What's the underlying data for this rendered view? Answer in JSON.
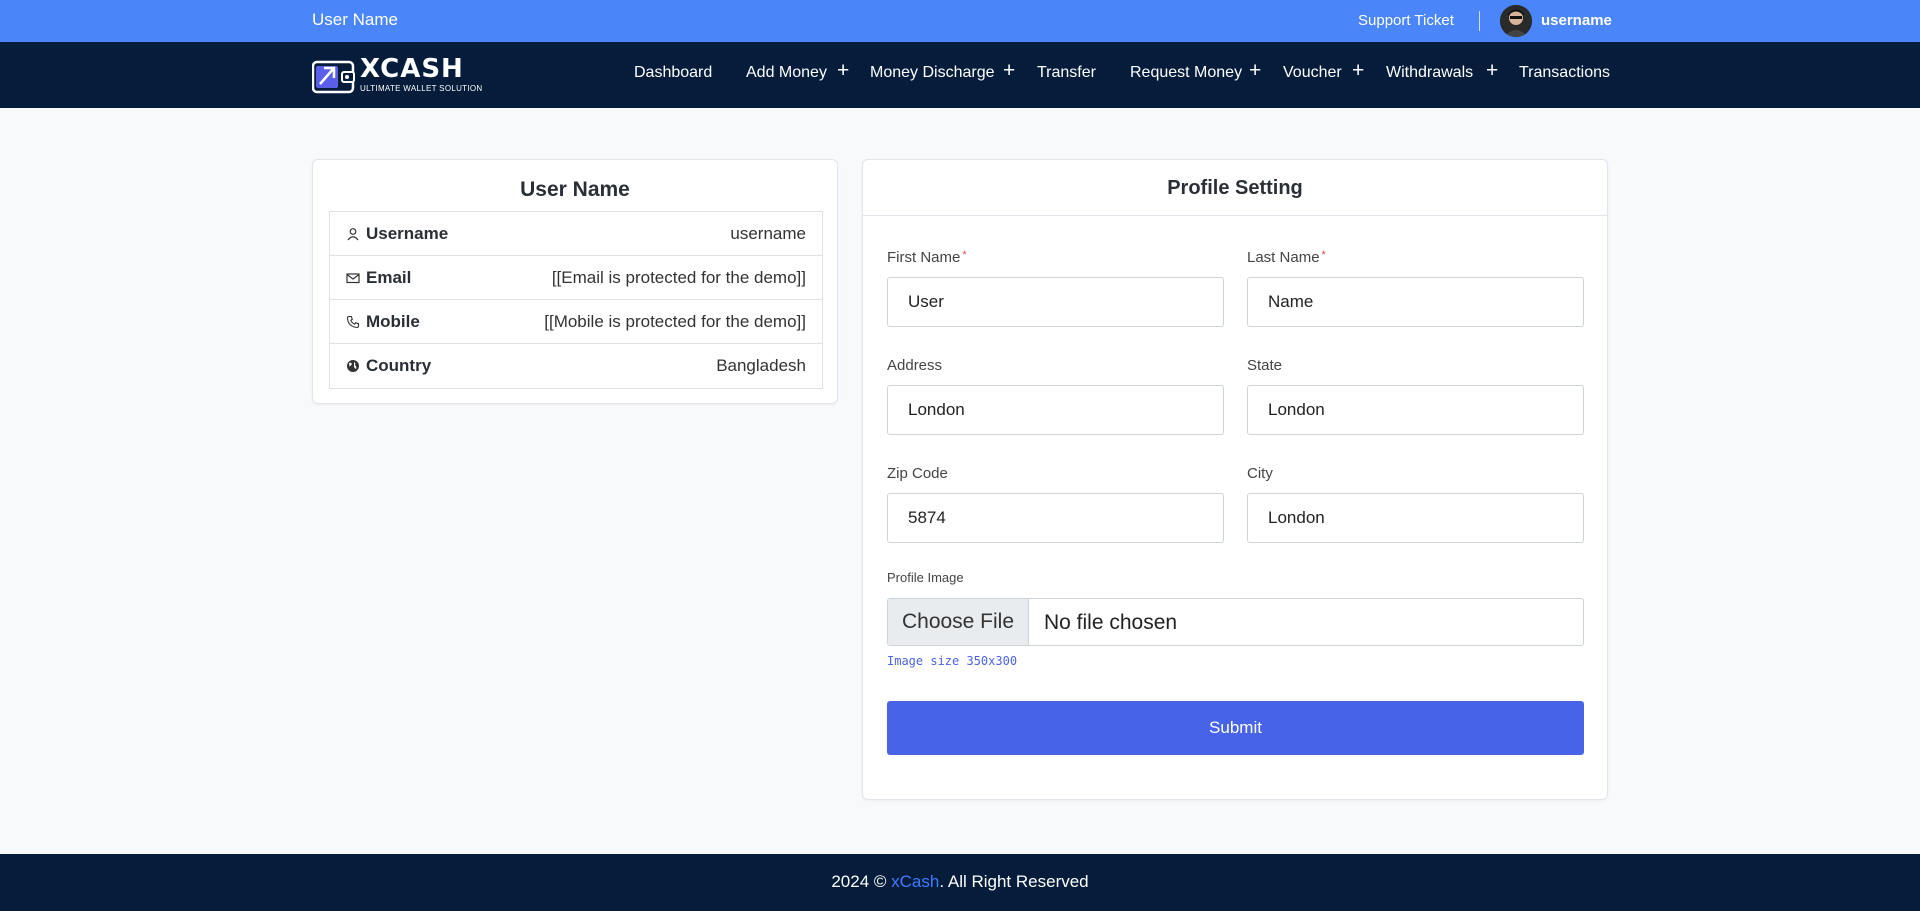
{
  "topbar": {
    "user_name": "User Name",
    "support_link": "Support Ticket",
    "username": "username"
  },
  "nav": {
    "logo_text": "XCASH",
    "logo_tagline": "ULTIMATE WALLET SOLUTION",
    "items": [
      "Dashboard",
      "Add Money",
      "Money Discharge",
      "Transfer",
      "Request Money",
      "Voucher",
      "Withdrawals",
      "Transactions"
    ],
    "plus": "+"
  },
  "info_card": {
    "title": "User Name",
    "rows": [
      {
        "icon": "user-icon",
        "label": "Username",
        "value": "username"
      },
      {
        "icon": "mail-icon",
        "label": "Email",
        "value": "[[Email is protected for the demo]]"
      },
      {
        "icon": "phone-icon",
        "label": "Mobile",
        "value": "[[Mobile is protected for the demo]]"
      },
      {
        "icon": "globe-icon",
        "label": "Country",
        "value": "Bangladesh"
      }
    ]
  },
  "profile_form": {
    "title": "Profile Setting",
    "first_name_label": "First Name",
    "first_name_value": "User",
    "last_name_label": "Last Name",
    "last_name_value": "Name",
    "required_mark": "*",
    "address_label": "Address",
    "address_value": "London",
    "state_label": "State",
    "state_value": "London",
    "zip_label": "Zip Code",
    "zip_value": "5874",
    "city_label": "City",
    "city_value": "London",
    "image_label": "Profile Image",
    "file_button": "Choose File",
    "file_status": "No file chosen",
    "image_hint": "Image size 350x300",
    "submit": "Submit"
  },
  "footer": {
    "year": "2024 ©",
    "brand": "xCash",
    "rights": ". All Right Reserved"
  },
  "colors": {
    "topbar": "#4a85f9",
    "navbar": "#051c3b",
    "primary": "#4764e8",
    "footer_brand": "#3d7bff"
  }
}
